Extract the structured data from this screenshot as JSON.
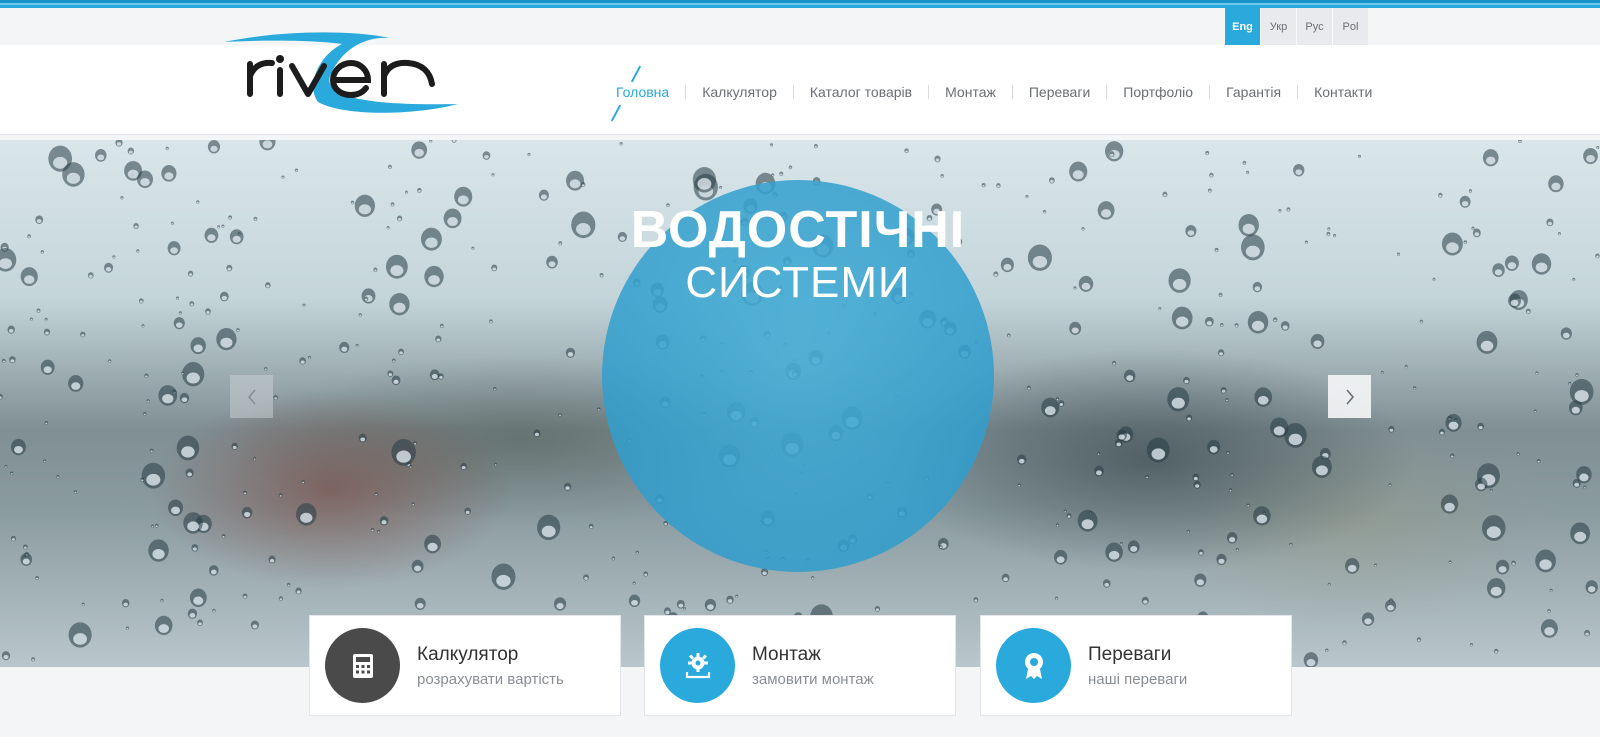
{
  "languages": [
    {
      "label": "Eng",
      "active": true
    },
    {
      "label": "Укр",
      "active": false
    },
    {
      "label": "Рус",
      "active": false
    },
    {
      "label": "Pol",
      "active": false
    }
  ],
  "logo": {
    "text": "river"
  },
  "nav": [
    {
      "label": "Головна",
      "active": true
    },
    {
      "label": "Калкулятор",
      "active": false
    },
    {
      "label": "Каталог товарів",
      "active": false
    },
    {
      "label": "Монтаж",
      "active": false
    },
    {
      "label": "Переваги",
      "active": false
    },
    {
      "label": "Портфоліо",
      "active": false
    },
    {
      "label": "Гарантія",
      "active": false
    },
    {
      "label": "Контакти",
      "active": false
    }
  ],
  "hero": {
    "title": "ВОДОСТІЧНІ",
    "subtitle": "СИСТЕМИ",
    "prev_icon": "chevron-left-icon",
    "next_icon": "chevron-right-icon"
  },
  "cards": [
    {
      "title": "Калкулятор",
      "subtitle": "розрахувати вартість",
      "icon": "calculator-icon",
      "color": "#4a4a4a"
    },
    {
      "title": "Монтаж",
      "subtitle": "замовити монтаж",
      "icon": "gear-icon",
      "color": "#2aa9dc"
    },
    {
      "title": "Переваги",
      "subtitle": "наші переваги",
      "icon": "award-icon",
      "color": "#2aa9dc"
    }
  ],
  "colors": {
    "accent": "#2aa9dc",
    "dark": "#4a4a4a"
  }
}
